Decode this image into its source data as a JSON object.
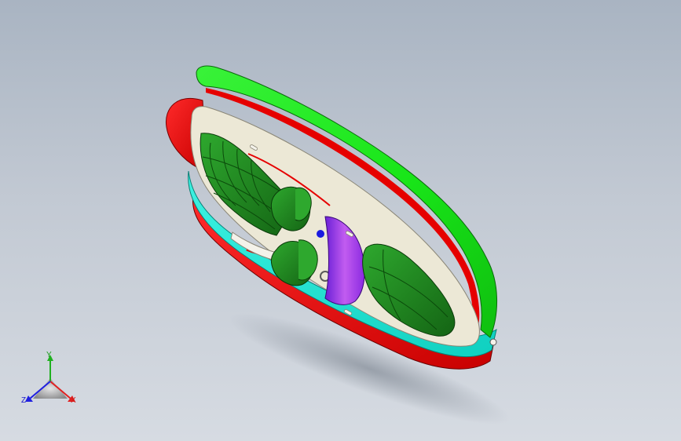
{
  "viewport": {
    "background_top": "#a9b4c2",
    "background_bottom": "#d6dbe2"
  },
  "model": {
    "description_icon": "boat-3d-model",
    "colors": {
      "hull_top": "#19e619",
      "hull_stripe": "#e60000",
      "hull_band": "#14e6d6",
      "deck": "#ece8d6",
      "seats": "#1f8a1f",
      "windshield": "#a53de6",
      "engine_pod": "#e61010"
    }
  },
  "triad": {
    "icon": "coordinate-triad-icon",
    "y_label": "Y",
    "x_label": "X",
    "z_label": "Z",
    "colors": {
      "x": "#e02020",
      "y": "#20b020",
      "z": "#2020e0"
    }
  }
}
